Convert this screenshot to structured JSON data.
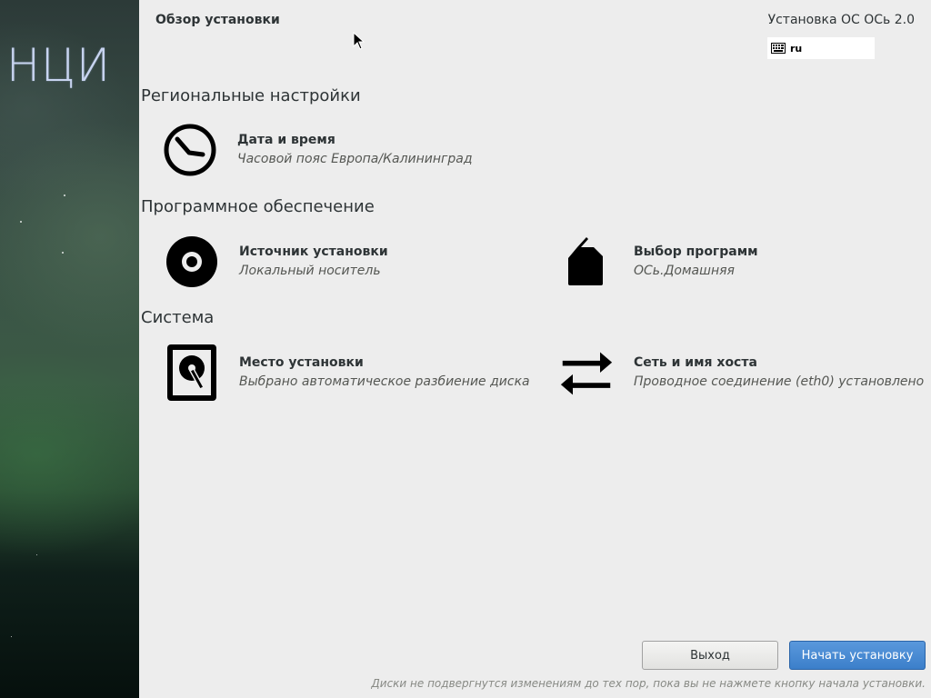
{
  "sidebar": {
    "logo_text": "НЦИ"
  },
  "header": {
    "page_title": "Обзор установки",
    "product_title": "Установка ОС ОСь 2.0",
    "keyboard_layout": "ru"
  },
  "sections": {
    "localization": {
      "title": "Региональные настройки",
      "datetime": {
        "title": "Дата и время",
        "status": "Часовой пояс Европа/Калининград",
        "icon": "clock-icon"
      }
    },
    "software": {
      "title": "Программное обеспечение",
      "source": {
        "title": "Источник установки",
        "status": "Локальный носитель",
        "icon": "disc-icon"
      },
      "selection": {
        "title": "Выбор программ",
        "status": "ОСь.Домашняя",
        "icon": "package-icon"
      }
    },
    "system": {
      "title": "Система",
      "destination": {
        "title": "Место установки",
        "status": "Выбрано автоматическое разбиение диска",
        "icon": "hard-drive-icon"
      },
      "network": {
        "title": "Сеть и имя хоста",
        "status": "Проводное соединение (eth0) установлено",
        "icon": "network-arrows-icon"
      }
    }
  },
  "footer": {
    "quit_label": "Выход",
    "begin_label": "Начать установку",
    "note": "Диски не подвергнутся изменениям до тех пор, пока вы не нажмете кнопку начала установки."
  },
  "colors": {
    "background": "#ededed",
    "primary_button": "#4a8bd4",
    "text": "#2e3436",
    "status_text": "#555753"
  }
}
